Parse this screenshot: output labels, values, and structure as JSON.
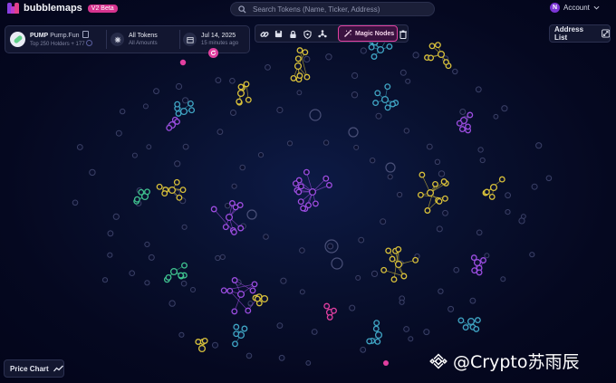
{
  "app": {
    "name": "bubblemaps",
    "badge": "V2 Beta"
  },
  "search": {
    "placeholder": "Search Tokens (Name, Ticker, Address)"
  },
  "account": {
    "avatar_letter": "N",
    "label": "Account"
  },
  "token_panel": {
    "symbol": "PUMP",
    "name": "Pump.Fun",
    "holders_summary": "Top 250 Holders + 177",
    "filter_title": "All Tokens",
    "filter_sub": "All Amounts",
    "date": "Jul 14, 2025",
    "updated": "15 minutes ago"
  },
  "toolbar": {
    "icons": [
      "link-icon",
      "save-icon",
      "lock-icon",
      "shield-icon",
      "network-icon"
    ],
    "magic_nodes_label": "Magic Nodes",
    "trash_icon": "trash-icon"
  },
  "address_list": {
    "label": "Address List"
  },
  "price_chart": {
    "label": "Price Chart"
  },
  "watermark": {
    "text": "@Crypto苏雨辰"
  },
  "colors": {
    "background": "#060a24",
    "accent": "#e040a0",
    "purple": "#9b4de0",
    "yellow": "#d8c13a",
    "cyan": "#3fa6c4",
    "green": "#3fc48f",
    "pink": "#e23fa0",
    "dim": "#3a4066"
  }
}
